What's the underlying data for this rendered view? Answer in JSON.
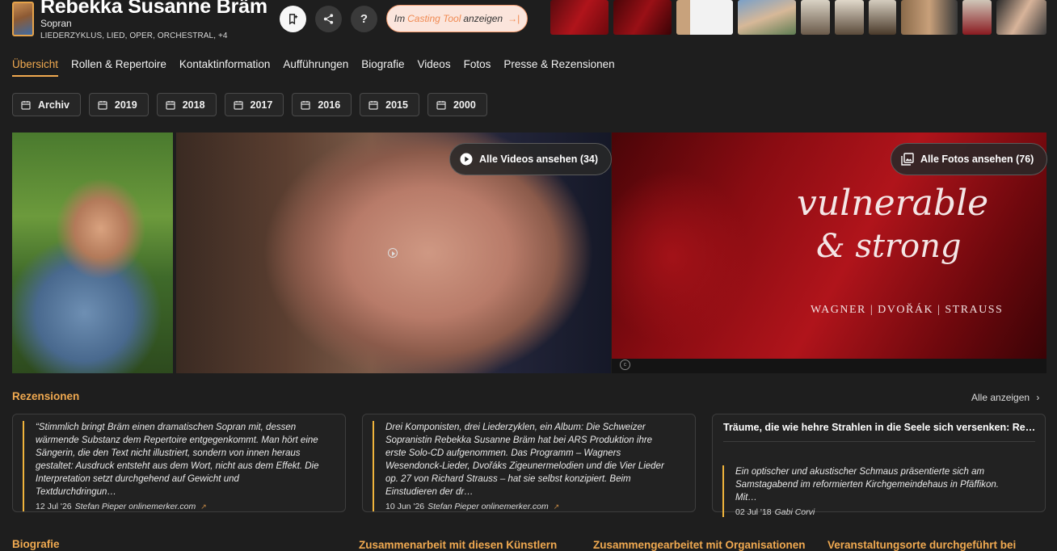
{
  "artist": {
    "name": "Rebekka Susanne Bräm",
    "voice": "Sopran",
    "genres": "LIEDERZYKLUS, LIED, OPER, ORCHESTRAL, +4"
  },
  "header": {
    "casting_pre": "Im",
    "casting_hl": "Casting Tool",
    "casting_post": "anzeigen",
    "casting_arrow": "→|",
    "bookmark_icon": "bookmark-add-icon",
    "share_icon": "share-icon",
    "help_label": "?"
  },
  "tabs": [
    {
      "label": "Übersicht"
    },
    {
      "label": "Rollen & Repertoire"
    },
    {
      "label": "Kontaktinformation"
    },
    {
      "label": "Aufführungen"
    },
    {
      "label": "Biografie"
    },
    {
      "label": "Videos"
    },
    {
      "label": "Fotos"
    },
    {
      "label": "Presse & Rezensionen"
    }
  ],
  "years": [
    "Archiv",
    "2019",
    "2018",
    "2017",
    "2016",
    "2015",
    "2000"
  ],
  "media": {
    "videos_btn": "Alle Videos ansehen (34)",
    "photos_btn": "Alle Fotos ansehen (76)",
    "cd_title_1": "vulnerable",
    "cd_title_2": "& strong",
    "cd_subtitle": "WAGNER | DVOŘÁK | STRAUSS"
  },
  "reviews": {
    "title": "Rezensionen",
    "show_all": "Alle anzeigen",
    "items": [
      {
        "text": "“Stimmlich bringt Bräm einen dramatischen Sopran mit, dessen wärmende Substanz dem Repertoire entgegenkommt. Man hört eine Sängerin, die den Text nicht illustriert, sondern von innen heraus gestaltet: Ausdruck entsteht aus dem Wort, nicht aus dem Effekt. Die Interpretation setzt durchgehend auf Gewicht und Textdurchdringun…",
        "date": "12 Jul '26",
        "author": "Stefan Pieper onlinemerker.com"
      },
      {
        "text": "Drei Komponisten, drei Liederzyklen, ein Album: Die Schweizer Sopranistin Rebekka Susanne Bräm hat bei ARS Produktion ihre erste Solo-CD aufgenommen. Das Programm – Wagners Wesendonck-Lieder, Dvořáks Zigeunermelodien und die Vier Lieder op. 27 von Richard Strauss – hat sie selbst konzipiert. Beim Einstudieren der dr…",
        "date": "10 Jun '26",
        "author": "Stefan Pieper onlinemerker.com"
      },
      {
        "title": "Träume, die wie hehre Strahlen in die Seele sich versenken: Re…",
        "text": "Ein optischer und akustischer Schmaus präsentierte sich am Samstagabend im reformierten Kirchgemeindehaus in Pfäffikon. Mit…",
        "date": "02 Jul '18",
        "author": "Gabi Corvi"
      }
    ]
  },
  "bottom_sections": [
    "Biografie",
    "Zusammenarbeit mit diesen Künstlern",
    "Zusammengearbeitet mit Organisationen",
    "Veranstaltungsorte durchgeführt bei"
  ],
  "colors": {
    "accent": "#f0a950",
    "background": "#1e1e1e",
    "card_border": "#3d3d3d",
    "quote_bar": "#f0b43c"
  }
}
